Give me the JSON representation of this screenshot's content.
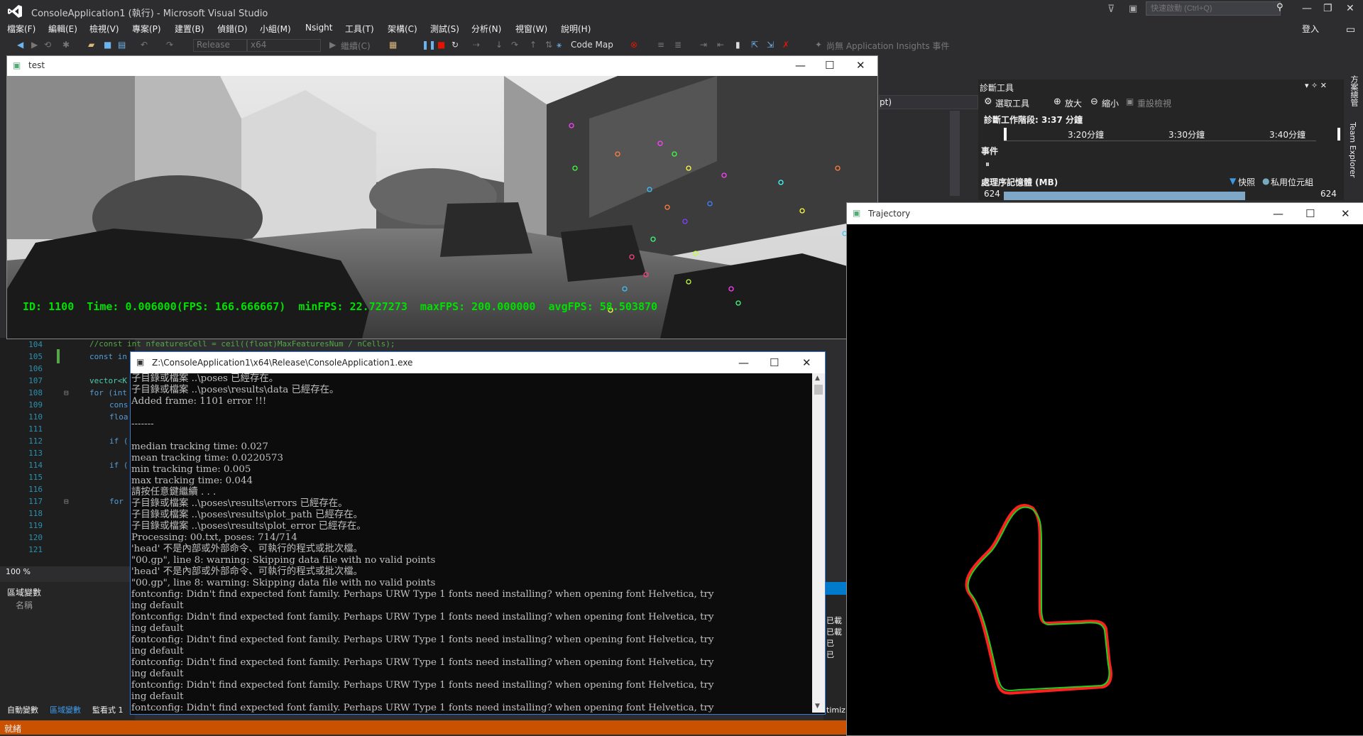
{
  "vs": {
    "title": "ConsoleApplication1 (執行) - Microsoft Visual Studio",
    "quick_launch_placeholder": "快速啟動 (Ctrl+Q)",
    "sign_in": "登入",
    "menu": [
      "檔案(F)",
      "編輯(E)",
      "檢視(V)",
      "專案(P)",
      "建置(B)",
      "偵錯(D)",
      "小組(M)",
      "Nsight",
      "工具(T)",
      "架構(C)",
      "測試(S)",
      "分析(N)",
      "視窗(W)",
      "說明(H)"
    ],
    "toolbar": {
      "config": "Release",
      "platform": "x64",
      "continue": "繼續(C)",
      "code_map": "Code Map",
      "insights": "尚無 Application Insights 事件"
    },
    "status_text": "就緒",
    "zoom": "100 %"
  },
  "diag": {
    "title": "診斷工具",
    "select_tool": "選取工具",
    "zoom_in": "放大",
    "zoom_out": "縮小",
    "reset": "重設檢視",
    "session": "診斷工作階段: 3:37 分鐘",
    "ticks": [
      "3:20分鐘",
      "3:30分鐘",
      "3:40分鐘"
    ],
    "events": "事件",
    "memory": "處理序記憶體 (MB)",
    "snapshot": "快照",
    "private_bytes": "私用位元組",
    "mem_value": "624",
    "dropdown_frag": "pt)",
    "side_tab1": "方案總管",
    "side_tab2": "Team Explorer"
  },
  "editor": {
    "lines": [
      "104",
      "105",
      "106",
      "107",
      "108",
      "109",
      "110",
      "111",
      "112",
      "113",
      "114",
      "115",
      "116",
      "117",
      "118",
      "119",
      "120",
      "121"
    ],
    "line104_code": "//const int nfeaturesCell = ceil((float)MaxFeaturesNum / nCells);",
    "line105_code": "const in",
    "frag107": "vector<K",
    "frag108": "for (int",
    "frag109": "cons",
    "frag110": "floa",
    "frag112": "if (",
    "frag114": "if (",
    "frag117": "for"
  },
  "bottom": {
    "locals_title": "區域變數",
    "name_col": "名稱",
    "tabs": [
      "自動變數",
      "區域變數",
      "監看式 1"
    ],
    "right_frags": [
      "已載",
      "已載",
      "已",
      "已"
    ],
    "timiz": "timiz"
  },
  "test_window": {
    "title": "test",
    "hud": "ID: 1100  Time: 0.006000(FPS: 166.666667)  minFPS: 22.727273  maxFPS: 200.000000  avgFPS: 58.503870"
  },
  "console": {
    "title": "Z:\\ConsoleApplication1\\x64\\Release\\ConsoleApplication1.exe",
    "lines": [
      "子目錄或檔案 ..\\poses 已經存在。",
      "子目錄或檔案 ..\\poses\\results\\data 已經存在。",
      "Added frame: 1101 error !!!",
      "",
      "-------",
      "",
      "median tracking time: 0.027",
      "mean tracking time: 0.0220573",
      "min tracking time: 0.005",
      "max tracking time: 0.044",
      "請按任意鍵繼續 . . .",
      "子目錄或檔案 ..\\poses\\results\\errors 已經存在。",
      "子目錄或檔案 ..\\poses\\results\\plot_path 已經存在。",
      "子目錄或檔案 ..\\poses\\results\\plot_error 已經存在。",
      "Processing: 00.txt, poses: 714/714",
      "'head' 不是內部或外部命令、可執行的程式或批次檔。",
      "\"00.gp\", line 8: warning: Skipping data file with no valid points",
      "'head' 不是內部或外部命令、可執行的程式或批次檔。",
      "\"00.gp\", line 8: warning: Skipping data file with no valid points",
      "fontconfig: Didn't find expected font family. Perhaps URW Type 1 fonts need installing? when opening font Helvetica, try",
      "ing default",
      "fontconfig: Didn't find expected font family. Perhaps URW Type 1 fonts need installing? when opening font Helvetica, try",
      "ing default",
      "fontconfig: Didn't find expected font family. Perhaps URW Type 1 fonts need installing? when opening font Helvetica, try",
      "ing default",
      "fontconfig: Didn't find expected font family. Perhaps URW Type 1 fonts need installing? when opening font Helvetica, try",
      "ing default",
      "fontconfig: Didn't find expected font family. Perhaps URW Type 1 fonts need installing? when opening font Helvetica, try",
      "ing default",
      "fontconfig: Didn't find expected font family. Perhaps URW Type 1 fonts need installing? when opening font Helvetica, try"
    ]
  },
  "trajectory": {
    "title": "Trajectory",
    "gt_color": "#ff2020",
    "est_color": "#20d020"
  },
  "colors": {
    "accent": "#007acc",
    "status_bar": "#ca5100",
    "hud": "#00e000"
  }
}
